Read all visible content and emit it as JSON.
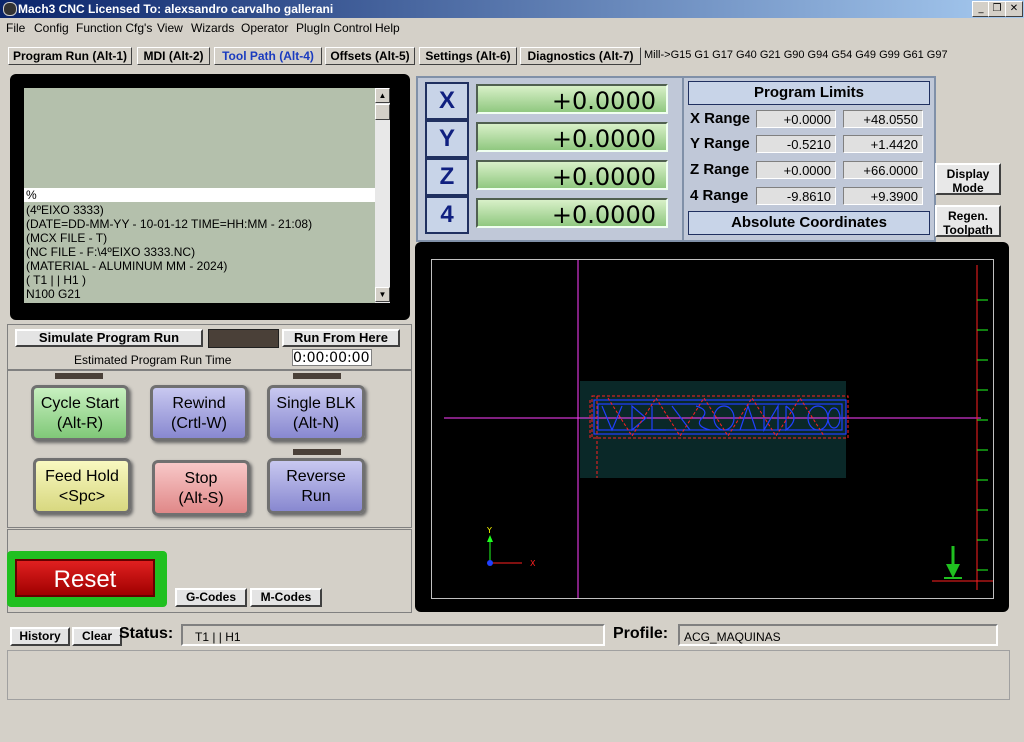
{
  "window": {
    "title": "Mach3 CNC  Licensed To: alexsandro carvalho gallerani"
  },
  "menu": [
    "File",
    "Config",
    "Function Cfg's",
    "View",
    "Wizards",
    "Operator",
    "PlugIn Control",
    "Help"
  ],
  "tabs": [
    {
      "label": "Program Run (Alt-1)"
    },
    {
      "label": "MDI (Alt-2)"
    },
    {
      "label": "Tool Path (Alt-4)",
      "active": true
    },
    {
      "label": "Offsets (Alt-5)"
    },
    {
      "label": "Settings (Alt-6)"
    },
    {
      "label": "Diagnostics (Alt-7)"
    }
  ],
  "modal_gcodes": "Mill->G15  G1 G17 G40 G21 G90 G94 G54 G49 G99 G61 G97",
  "gcode_lines": [
    "%",
    "(4ºEIXO 3333)",
    "(DATE=DD-MM-YY - 10-01-12 TIME=HH:MM - 21:08)",
    "(MCX FILE - T)",
    "(NC FILE - F:\\4ºEIXO 3333.NC)",
    "(MATERIAL - ALUMINUM MM - 2024)",
    "( T1 | | H1 )",
    "N100 G21"
  ],
  "dro": [
    {
      "axis": "X",
      "value": "+0.0000"
    },
    {
      "axis": "Y",
      "value": "+0.0000"
    },
    {
      "axis": "Z",
      "value": "+0.0000"
    },
    {
      "axis": "4",
      "value": "+0.0000"
    }
  ],
  "limits": {
    "title": "Program Limits",
    "rows": [
      {
        "label": "X Range",
        "min": "+0.0000",
        "max": "+48.0550"
      },
      {
        "label": "Y Range",
        "min": "-0.5210",
        "max": "+1.4420"
      },
      {
        "label": "Z Range",
        "min": "+0.0000",
        "max": "+66.0000"
      },
      {
        "label": "4 Range",
        "min": "-9.8610",
        "max": "+9.3900"
      }
    ],
    "coord_mode": "Absolute Coordinates"
  },
  "side_buttons": {
    "display_mode": [
      "Display",
      "Mode"
    ],
    "regen": [
      "Regen.",
      "Toolpath"
    ]
  },
  "sim": {
    "simulate": "Simulate Program Run",
    "run_from_here": "Run From Here",
    "est_label": "Estimated Program Run Time",
    "est_value": "0:00:00:00"
  },
  "controls": {
    "cycle_start": [
      "Cycle Start",
      "(Alt-R)"
    ],
    "rewind": [
      "Rewind",
      "(Crtl-W)"
    ],
    "single_blk": [
      "Single BLK",
      "(Alt-N)"
    ],
    "feed_hold": [
      "Feed Hold",
      "<Spc>"
    ],
    "stop": [
      "Stop",
      "(Alt-S)"
    ],
    "reverse": [
      "Reverse",
      "Run"
    ]
  },
  "reset": "Reset",
  "code_buttons": {
    "g_codes": "G-Codes",
    "m_codes": "M-Codes"
  },
  "status": {
    "history": "History",
    "clear": "Clear",
    "label": "Status:",
    "value": "T1 | | H1",
    "profile_label": "Profile:",
    "profile_value": "ACG_MAQUINAS"
  },
  "colors": {
    "dro_green": "#90c880",
    "toolpath_blue": "#2040ff",
    "toolpath_red": "#ff2020",
    "crosshair": "#ff40ff"
  }
}
